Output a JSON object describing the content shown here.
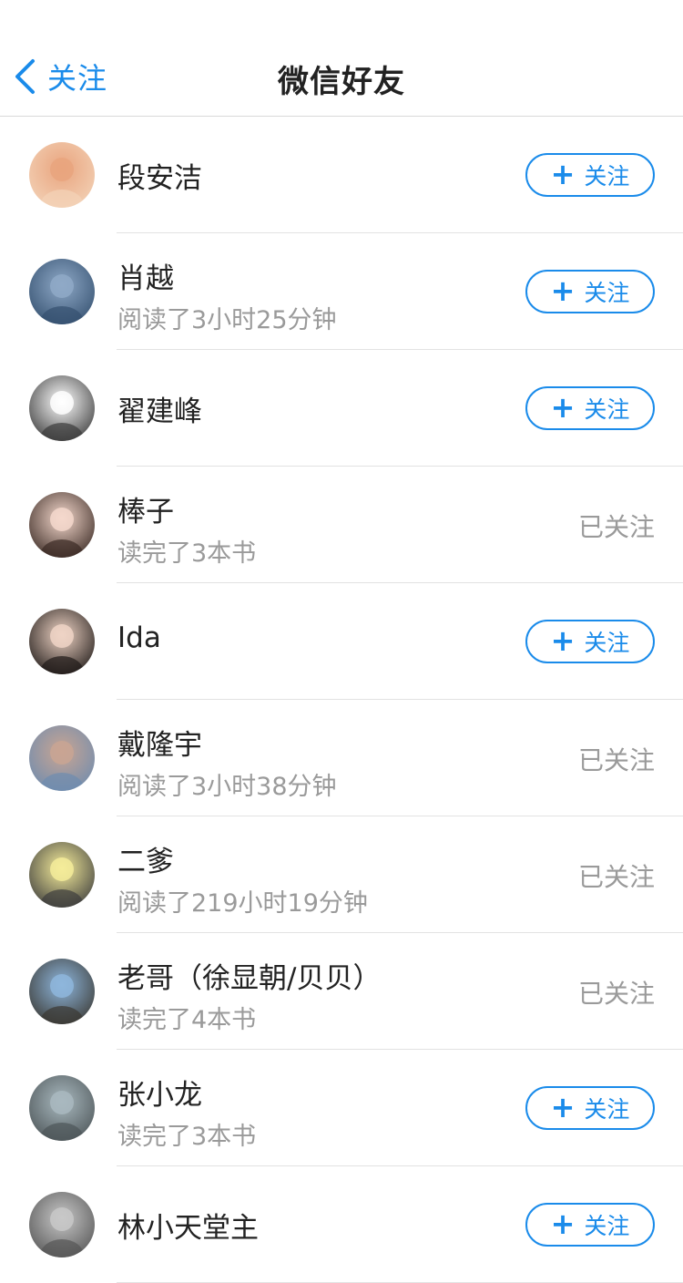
{
  "nav": {
    "back_label": "关注",
    "title": "微信好友"
  },
  "follow_button_label": "关注",
  "followed_label": "已关注",
  "friends": [
    {
      "name": "段安洁",
      "subtitle": "",
      "followed": false,
      "avatar_colors": [
        "#e9a47e",
        "#f3d3b8"
      ]
    },
    {
      "name": "肖越",
      "subtitle": "阅读了3小时25分钟",
      "followed": false,
      "avatar_colors": [
        "#8fa9c7",
        "#34506f"
      ]
    },
    {
      "name": "翟建峰",
      "subtitle": "",
      "followed": false,
      "avatar_colors": [
        "#ffffff",
        "#3a3a3a"
      ]
    },
    {
      "name": "棒子",
      "subtitle": "读完了3本书",
      "followed": true,
      "avatar_colors": [
        "#f4d8cc",
        "#3a2a24"
      ]
    },
    {
      "name": "Ida",
      "subtitle": "",
      "followed": false,
      "avatar_colors": [
        "#efd4c5",
        "#1f1a18"
      ]
    },
    {
      "name": "戴隆宇",
      "subtitle": "阅读了3小时38分钟",
      "followed": true,
      "avatar_colors": [
        "#c9a593",
        "#6e8caf"
      ]
    },
    {
      "name": "二爹",
      "subtitle": "阅读了219小时19分钟",
      "followed": true,
      "avatar_colors": [
        "#f5ec9a",
        "#3d3d3d"
      ]
    },
    {
      "name": "老哥（徐显朝/贝贝）",
      "subtitle": "读完了4本书",
      "followed": true,
      "avatar_colors": [
        "#8eb6dc",
        "#3a3832"
      ]
    },
    {
      "name": "张小龙",
      "subtitle": "读完了3本书",
      "followed": false,
      "avatar_colors": [
        "#a9b9bf",
        "#4d5558"
      ]
    },
    {
      "name": "林小天堂主",
      "subtitle": "",
      "followed": false,
      "avatar_colors": [
        "#c8c8c8",
        "#555555"
      ]
    }
  ],
  "colors": {
    "accent": "#1a8bea",
    "secondary_text": "#9a9a9a",
    "divider": "#e2e2e2"
  }
}
